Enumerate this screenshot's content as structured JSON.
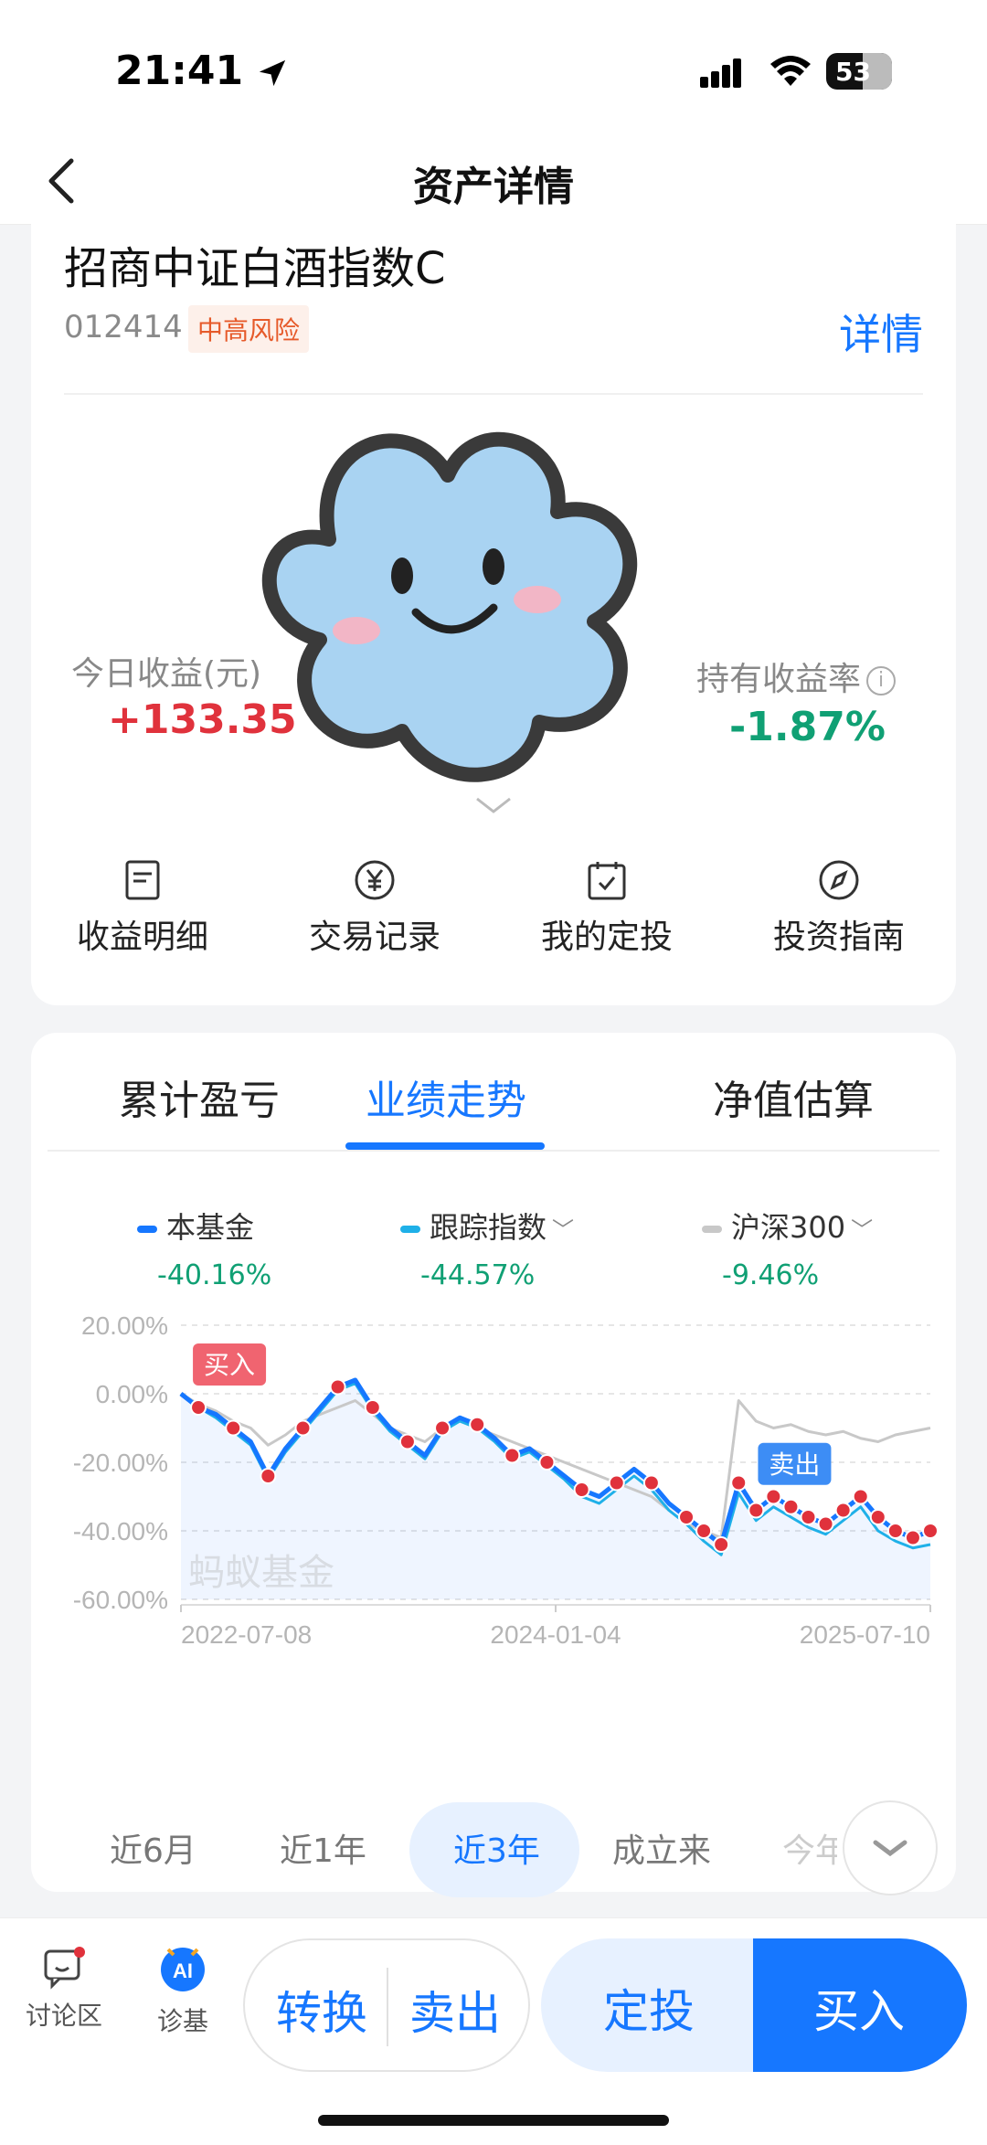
{
  "status": {
    "time": "21:41",
    "battery": "53"
  },
  "nav": {
    "title": "资产详情"
  },
  "fund": {
    "name": "招商中证白酒指数C",
    "code": "012414",
    "risk": "中高风险",
    "detail_link": "详情"
  },
  "earnings": {
    "today_label": "今日收益(元)",
    "today_value": "+133.35",
    "hold_label": "持有收益率",
    "hold_value": "-1.87%"
  },
  "quick_actions": [
    {
      "label": "收益明细",
      "icon": "document-icon"
    },
    {
      "label": "交易记录",
      "icon": "yen-circle-icon"
    },
    {
      "label": "我的定投",
      "icon": "calendar-check-icon"
    },
    {
      "label": "投资指南",
      "icon": "compass-icon"
    }
  ],
  "tabs": [
    "累计盈亏",
    "业绩走势",
    "净值估算"
  ],
  "active_tab": "业绩走势",
  "legend": [
    {
      "name": "本基金",
      "value": "-40.16%",
      "color": "#1677ff"
    },
    {
      "name": "跟踪指数",
      "value": "-44.57%",
      "color": "#1fb0e8"
    },
    {
      "name": "沪深300",
      "value": "-9.46%",
      "color": "#c8c8c8"
    }
  ],
  "chart_data": {
    "type": "line",
    "y_ticks": [
      "20.00%",
      "0.00%",
      "-20.00%",
      "-40.00%",
      "-60.00%"
    ],
    "ylim": [
      -60,
      20
    ],
    "x_ticks": [
      "2022-07-08",
      "2024-01-04",
      "2025-07-10"
    ],
    "watermark": "蚂蚁基金",
    "series": [
      {
        "name": "本基金",
        "color": "#1677ff",
        "values": [
          0,
          -4,
          -6,
          -10,
          -14,
          -24,
          -16,
          -10,
          -4,
          2,
          4,
          -4,
          -10,
          -14,
          -18,
          -10,
          -7,
          -9,
          -13,
          -18,
          -16,
          -20,
          -24,
          -28,
          -30,
          -26,
          -22,
          -26,
          -32,
          -36,
          -40,
          -44,
          -26,
          -34,
          -30,
          -33,
          -36,
          -38,
          -34,
          -30,
          -36,
          -40,
          -42,
          -40
        ]
      },
      {
        "name": "跟踪指数",
        "color": "#1fb0e8",
        "values": [
          0,
          -4,
          -7,
          -11,
          -15,
          -25,
          -17,
          -11,
          -5,
          1,
          3,
          -5,
          -11,
          -15,
          -19,
          -11,
          -8,
          -10,
          -14,
          -19,
          -17,
          -21,
          -25,
          -30,
          -32,
          -28,
          -24,
          -28,
          -34,
          -38,
          -43,
          -47,
          -29,
          -37,
          -33,
          -36,
          -39,
          -41,
          -37,
          -33,
          -40,
          -43,
          -45,
          -44
        ]
      },
      {
        "name": "沪深300",
        "color": "#c8c8c8",
        "values": [
          0,
          -3,
          -5,
          -8,
          -10,
          -15,
          -12,
          -8,
          -6,
          -4,
          -2,
          -6,
          -10,
          -12,
          -14,
          -10,
          -8,
          -10,
          -12,
          -14,
          -16,
          -18,
          -20,
          -22,
          -24,
          -26,
          -28,
          -30,
          -34,
          -38,
          -40,
          -42,
          -2,
          -8,
          -10,
          -9,
          -11,
          -12,
          -11,
          -13,
          -14,
          -12,
          -11,
          -10
        ]
      }
    ],
    "markers": [
      {
        "label": "买入",
        "index": 1
      },
      {
        "label": "卖出",
        "index": 35
      }
    ]
  },
  "ranges": [
    "近6月",
    "近1年",
    "近3年",
    "成立来",
    "今年"
  ],
  "active_range": "近3年",
  "bottom": {
    "discuss": "讨论区",
    "diagnose": "诊基",
    "ai_badge": "AI",
    "convert": "转换",
    "sell": "卖出",
    "fixed": "定投",
    "buy": "买入"
  }
}
